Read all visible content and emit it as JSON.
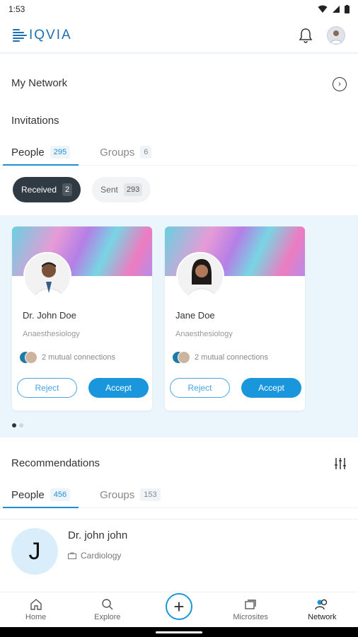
{
  "status_bar": {
    "time": "1:53"
  },
  "header": {
    "logo_text": "IQVIA"
  },
  "network": {
    "title": "My Network"
  },
  "invitations": {
    "title": "Invitations",
    "tabs": [
      {
        "label": "People",
        "count": "295"
      },
      {
        "label": "Groups",
        "count": "6"
      }
    ],
    "filters": [
      {
        "label": "Received",
        "count": "2"
      },
      {
        "label": "Sent",
        "count": "293"
      }
    ],
    "cards": [
      {
        "name": "Dr. John Doe",
        "specialty": "Anaesthesiology",
        "mutual": "2 mutual connections",
        "reject": "Reject",
        "accept": "Accept"
      },
      {
        "name": "Jane Doe",
        "specialty": "Anaesthesiology",
        "mutual": "2 mutual connections",
        "reject": "Reject",
        "accept": "Accept"
      }
    ]
  },
  "recommendations": {
    "title": "Recommendations",
    "tabs": [
      {
        "label": "People",
        "count": "456"
      },
      {
        "label": "Groups",
        "count": "153"
      }
    ],
    "items": [
      {
        "initial": "J",
        "name": "Dr. john john",
        "specialty": "Cardiology"
      }
    ]
  },
  "bottom_nav": {
    "items": [
      {
        "label": "Home",
        "icon": "home-icon"
      },
      {
        "label": "Explore",
        "icon": "search-icon"
      },
      {
        "label": "Microsites",
        "icon": "microsites-icon"
      },
      {
        "label": "Network",
        "icon": "network-icon"
      }
    ]
  },
  "colors": {
    "accent": "#1a97dc",
    "brand": "#1d6fb5",
    "dark_pill": "#2f3a42",
    "band": "#eaf5fc"
  }
}
